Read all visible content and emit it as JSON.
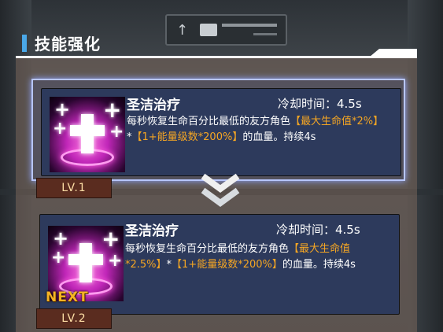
{
  "header": {
    "title": "技能强化"
  },
  "current": {
    "name": "圣洁治疗",
    "cooldown": "冷却时间：4.5s",
    "desc_a": "每秒恢复生命百分比最低的友方角色",
    "desc_hl1": "【最大生命值*2%】",
    "desc_b": "*",
    "desc_hl2": "【1+能量级数*200%】",
    "desc_c": "的血量。持续4s",
    "level": "LV.1"
  },
  "next": {
    "name": "圣洁治疗",
    "cooldown": "冷却时间：4.5s",
    "desc_a": "每秒恢复生命百分比最低的友方角色",
    "desc_hl1": "【最大生命值*2.5%】",
    "desc_b": "*",
    "desc_hl2": "【1+能量级数*200%】",
    "desc_c": "的血量。持续4s",
    "tag": "NEXT",
    "level": "LV.2"
  },
  "icons": {
    "skill": "holy-cross-icon",
    "arrow": "double-chevron-down-icon"
  },
  "colors": {
    "accent": "#4aa8e8",
    "highlight": "#f5a623",
    "level_bg": "#5a2c1f",
    "card_bg": "#2d3a5c"
  }
}
